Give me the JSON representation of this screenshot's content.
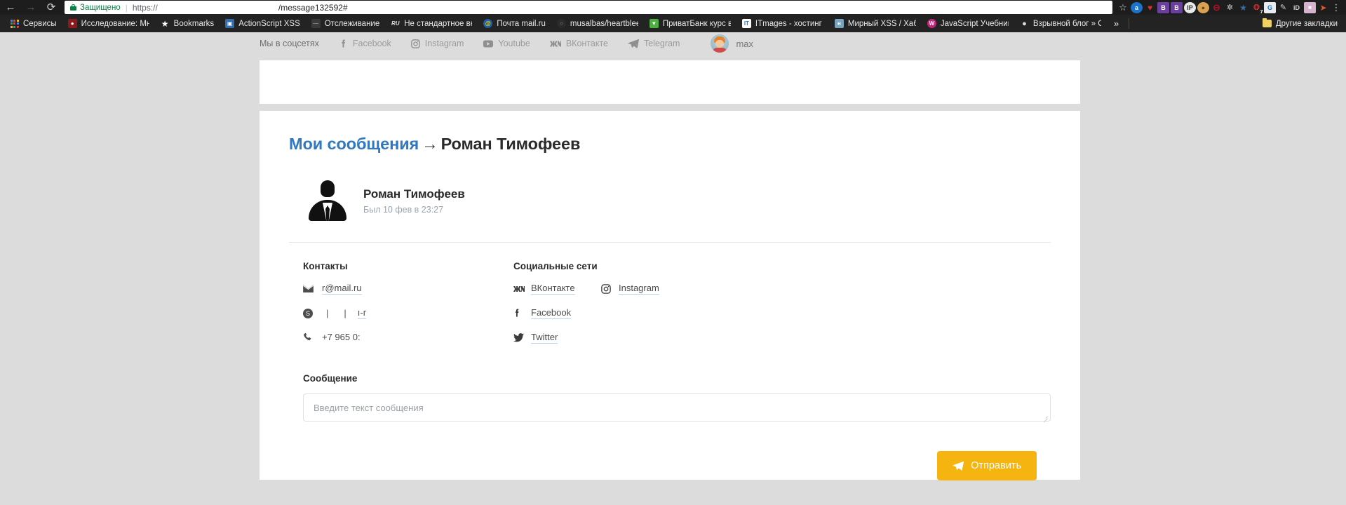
{
  "browser": {
    "nav": {
      "back_icon": "back-arrow-icon",
      "forward_icon": "forward-arrow-icon",
      "reload_icon": "reload-icon"
    },
    "omnibox": {
      "secure_label": "Защищено",
      "url_scheme": "https://",
      "url_path": "/message132592#",
      "lock_icon": "lock-icon",
      "bookmark_star_icon": "star-icon"
    },
    "extensions": [
      {
        "name": "adblock-extension",
        "glyph": "a",
        "color": "#1a73c8"
      },
      {
        "name": "heartbleed-extension",
        "glyph": "♥",
        "color": "#1d1d1d"
      },
      {
        "name": "bitwarden-extension",
        "glyph": "B",
        "color": "#6b3fa0"
      },
      {
        "name": "browser-extension-b",
        "glyph": "B",
        "color": "#6b3fa0"
      },
      {
        "name": "ip-lookup-extension",
        "glyph": "IP",
        "color": "#e9e9e9"
      },
      {
        "name": "cookie-manager-extension",
        "glyph": "●",
        "color": "#d9a152"
      },
      {
        "name": "ghostery-extension",
        "glyph": "⊖",
        "color": "#cf0a2c"
      },
      {
        "name": "proxy-extension",
        "glyph": "✇",
        "color": "#e6e6e6"
      },
      {
        "name": "shield-extension",
        "glyph": "⛨",
        "color": "#2a5d8f"
      },
      {
        "name": "notifications-extension",
        "glyph": "❖",
        "color": "#e23b3b",
        "badge": "7"
      },
      {
        "name": "google-translate-extension",
        "glyph": "G",
        "color": "#e8eaed"
      },
      {
        "name": "edit-pencil-extension",
        "glyph": "✎",
        "color": "#2a2a2a"
      },
      {
        "name": "identity-extension",
        "glyph": "iD",
        "color": "#2a2a2a"
      },
      {
        "name": "shopping-bag-extension",
        "glyph": "▣",
        "color": "#d5b3cf"
      },
      {
        "name": "firefox-like-extension",
        "glyph": "◆",
        "color": "#e2572a"
      }
    ],
    "menu_icon": "kebab-menu-icon",
    "bookmarks": [
      {
        "label": "Сервисы",
        "icon": "apps-grid-icon",
        "color": ""
      },
      {
        "label": "Исследование: Мно",
        "icon": "favicon-research",
        "color": "#8c1a1a"
      },
      {
        "label": "Bookmarks",
        "icon": "star-icon",
        "color": ""
      },
      {
        "label": "ActionScript XSS",
        "icon": "favicon-actionscript",
        "color": "#2f6fb0"
      },
      {
        "label": "Отслеживание",
        "icon": "favicon-tracking",
        "color": "#3a3a3a"
      },
      {
        "label": "Не стандартное вне",
        "icon": "favicon-ru",
        "color": "#2b2b2b"
      },
      {
        "label": "Почта mail.ru",
        "icon": "favicon-mailru",
        "color": "#1d5fa8"
      },
      {
        "label": "musalbas/heartbleed",
        "icon": "favicon-github",
        "color": "#2b2b2b"
      },
      {
        "label": "ПриватБанк курс ва",
        "icon": "favicon-privatbank",
        "color": "#4caf3f"
      },
      {
        "label": "ITmages - хостинг из",
        "icon": "favicon-itmages",
        "color": "#1f7fd4"
      },
      {
        "label": "Мирный XSS / Хабра",
        "icon": "favicon-habr",
        "color": "#7aa3bd"
      },
      {
        "label": "JavaScript Учебник -",
        "icon": "favicon-javascript",
        "color": "#c2267a"
      },
      {
        "label": "Взрывной блог » Сп",
        "icon": "favicon-blog",
        "color": "#2b2b2b"
      }
    ],
    "bookmarks_overflow_label": "»",
    "other_bookmarks_label": "Другие закладки",
    "other_bookmarks_icon": "folder-icon"
  },
  "social_bar": {
    "title": "Мы в соцсетях",
    "links": [
      {
        "label": "Facebook",
        "icon": "facebook-icon"
      },
      {
        "label": "Instagram",
        "icon": "instagram-icon"
      },
      {
        "label": "Youtube",
        "icon": "youtube-icon"
      },
      {
        "label": "ВКонтакте",
        "icon": "vk-icon"
      },
      {
        "label": "Telegram",
        "icon": "telegram-icon"
      }
    ],
    "user": {
      "name": "max",
      "avatar_icon": "user-avatar"
    }
  },
  "card": {
    "breadcrumb": {
      "link": "Мои сообщения",
      "arrow": "→",
      "current": "Роман Тимофеев"
    },
    "profile": {
      "name": "Роман Тимофеев",
      "status": "Был 10 фев в 23:27",
      "avatar_icon": "default-person-silhouette"
    },
    "contacts": {
      "title": "Контакты",
      "rows": [
        {
          "icon": "envelope-icon",
          "value": "r@mail.ru",
          "style": "link"
        },
        {
          "icon": "skype-icon",
          "value": "ı-г",
          "style": "redacted",
          "prefix": "|",
          "prefix2": "|"
        },
        {
          "icon": "phone-icon",
          "value": "+7 965 0:",
          "style": "plain"
        }
      ]
    },
    "socials": {
      "title": "Социальные сети",
      "column_a": [
        {
          "icon": "vk-icon",
          "label": "ВКонтакте"
        },
        {
          "icon": "facebook-icon",
          "label": "Facebook"
        },
        {
          "icon": "twitter-icon",
          "label": "Twitter"
        }
      ],
      "column_b": [
        {
          "icon": "instagram-icon",
          "label": "Instagram"
        }
      ]
    },
    "message": {
      "label": "Сообщение",
      "placeholder": "Введите текст сообщения",
      "value": ""
    },
    "send_button": {
      "label": "Отправить",
      "icon": "paper-plane-icon",
      "color": "#f5b40f"
    }
  }
}
